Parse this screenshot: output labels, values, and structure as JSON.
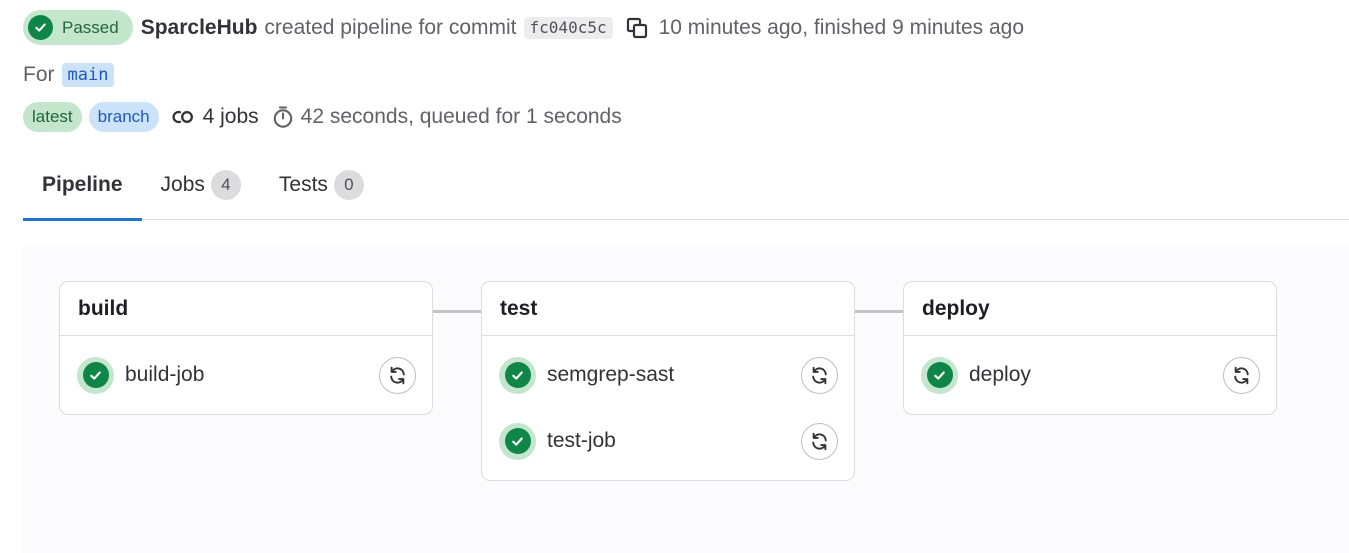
{
  "header": {
    "status_label": "Passed",
    "author": "SparcleHub",
    "created_text": "created pipeline for commit",
    "commit_sha": "fc040c5c",
    "timing_text": "10 minutes ago, finished 9 minutes ago",
    "for_label": "For",
    "ref": "main",
    "badges": [
      "latest",
      "branch"
    ],
    "jobs_text": "4 jobs",
    "duration_text": "42 seconds, queued for 1 seconds"
  },
  "tabs": [
    {
      "label": "Pipeline",
      "active": true
    },
    {
      "label": "Jobs",
      "count": "4"
    },
    {
      "label": "Tests",
      "count": "0"
    }
  ],
  "stages": [
    {
      "name": "build",
      "jobs": [
        {
          "name": "build-job",
          "status": "passed"
        }
      ]
    },
    {
      "name": "test",
      "jobs": [
        {
          "name": "semgrep-sast",
          "status": "passed"
        },
        {
          "name": "test-job",
          "status": "passed"
        }
      ]
    },
    {
      "name": "deploy",
      "jobs": [
        {
          "name": "deploy",
          "status": "passed"
        }
      ]
    }
  ],
  "colors": {
    "success": "#108548",
    "success_bg": "#c3e6cd",
    "accent": "#1f75cb",
    "ref_bg": "#cbe2f9",
    "graph_bg": "#fbfafd"
  },
  "icons": {
    "status": "check-circle-icon",
    "copy": "copy-icon",
    "jobs": "pipeline-link-icon",
    "duration": "timer-icon",
    "retry": "retry-icon"
  }
}
